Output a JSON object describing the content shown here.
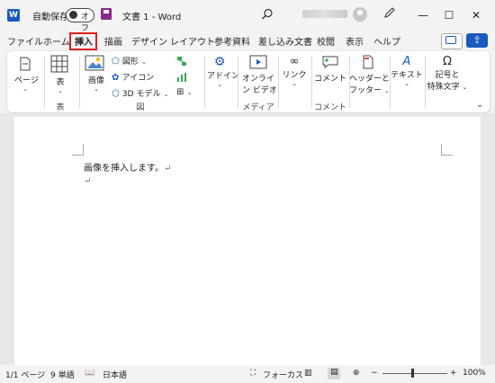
{
  "titlebar": {
    "app_logo": "W",
    "autosave_label": "自動保存",
    "autosave_state": "オフ",
    "document_title": "文書 1 - Word",
    "minimize": "—",
    "maximize": "☐",
    "close": "✕"
  },
  "tabs": [
    "ファイル",
    "ホーム",
    "挿入",
    "描画",
    "デザイン",
    "レイアウト",
    "参考資料",
    "差し込み文書",
    "校閲",
    "表示",
    "ヘルプ"
  ],
  "active_tab": "挿入",
  "ribbon": {
    "pages": "ページ",
    "table": "表",
    "table_group": "表",
    "image": "画像",
    "shapes": "図形",
    "icons": "アイコン",
    "models3d": "3D モデル",
    "illustrations_group": "図",
    "addins": "アドイン",
    "online_video_1": "オンライ",
    "online_video_2": "ン ビデオ",
    "media_group": "メディア",
    "link": "リンク",
    "comment": "コメント",
    "comment_group": "コメント",
    "header_footer_1": "ヘッダーと",
    "header_footer_2": "フッター",
    "text": "テキスト",
    "symbols_1": "記号と",
    "symbols_2": "特殊文字"
  },
  "document": {
    "line1": "画像を挿入します。",
    "para_mark": "↵"
  },
  "statusbar": {
    "page": "1/1 ページ",
    "words": "9 単語",
    "language": "日本語",
    "focus": "フォーカス",
    "zoom": "100%",
    "zoom_minus": "−",
    "zoom_plus": "+"
  },
  "colors": {
    "accent": "#185abd",
    "highlight_box": "#e0201e",
    "save_icon": "#8a2b8b"
  }
}
